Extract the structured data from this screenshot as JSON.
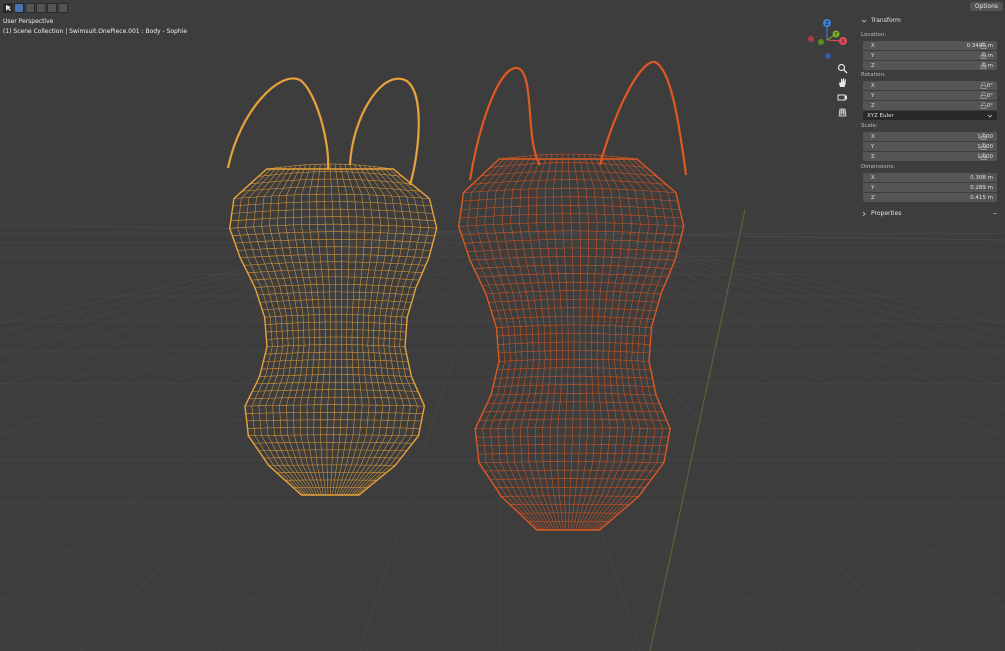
{
  "header": {
    "options_label": "Options",
    "view_name": "User Perspective",
    "collection_info": "(1) Scene Collection | Swimsuit.OnePiece.001 : Body - Sophie"
  },
  "gizmo": {
    "x_label": "X",
    "y_label": "Y",
    "z_label": "Z",
    "colors": {
      "x": "#e54a5c",
      "y": "#7ab32c",
      "z": "#3f7fd9"
    }
  },
  "nav_icons": [
    "zoom-icon",
    "hand-pan-icon",
    "camera-icon",
    "grid-perspective-icon"
  ],
  "sidebar": {
    "transform_title": "Transform",
    "location_label": "Location:",
    "location": [
      {
        "axis": "X",
        "value": "0.3480 m"
      },
      {
        "axis": "Y",
        "value": "0 m"
      },
      {
        "axis": "Z",
        "value": "0 m"
      }
    ],
    "rotation_label": "Rotation:",
    "rotation": [
      {
        "axis": "X",
        "value": "0°"
      },
      {
        "axis": "Y",
        "value": "0°"
      },
      {
        "axis": "Z",
        "value": "0°"
      }
    ],
    "rotation_mode": "XYZ Euler",
    "scale_label": "Scale:",
    "scale": [
      {
        "axis": "X",
        "value": "1.000"
      },
      {
        "axis": "Y",
        "value": "1.000"
      },
      {
        "axis": "Z",
        "value": "1.000"
      }
    ],
    "dimensions_label": "Dimensions:",
    "dimensions": [
      {
        "axis": "X",
        "value": "0.308 m"
      },
      {
        "axis": "Y",
        "value": "0.289 m"
      },
      {
        "axis": "Z",
        "value": "0.415 m"
      }
    ],
    "properties_title": "Properties"
  },
  "colors": {
    "viewport_bg": "#3d3d3d",
    "grid_line": "#474747",
    "wire_left": "#e8a23a",
    "wire_right": "#e0581f",
    "field_bg": "#555555"
  }
}
